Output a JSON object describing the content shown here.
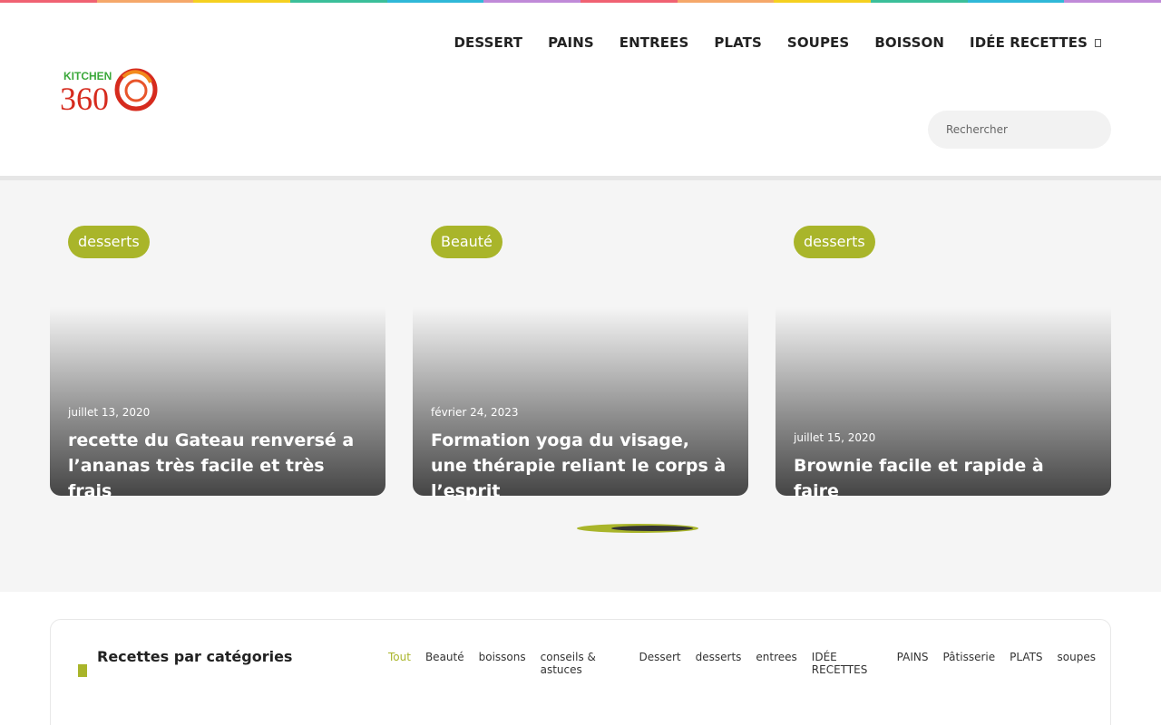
{
  "brand": {
    "logo_text_top": "KITCHEN",
    "logo_text_bottom": "360",
    "colors": {
      "accent": "#a9b52a",
      "logo_green": "#3aa83a",
      "logo_red": "#d62b1e",
      "logo_orange": "#f28a1c"
    }
  },
  "rainbow": [
    "#f06272",
    "#f5a86a",
    "#f5d020",
    "#3bbf9a",
    "#2fb8d8",
    "#c08ad8",
    "#f06272",
    "#f5a86a",
    "#f5d020",
    "#3bbf9a",
    "#2fb8d8",
    "#c08ad8"
  ],
  "nav": {
    "items": [
      "DESSERT",
      "PAINS",
      "ENTREES",
      "PLATS",
      "SOUPES",
      "BOISSON",
      "IDÉE RECETTES"
    ],
    "dropdown_icon": "chevron-down-icon"
  },
  "search": {
    "placeholder": "Rechercher"
  },
  "slider": {
    "cards": [
      {
        "tag": "desserts",
        "date": "juillet 13, 2020",
        "title": "recette du Gateau renversé a l’ananas très facile et très frais"
      },
      {
        "tag": "Beauté",
        "date": "février 24, 2023",
        "title": "Formation yoga du visage, une thérapie reliant le corps à l’esprit"
      },
      {
        "tag": "desserts",
        "date": "juillet 15, 2020",
        "title": "Brownie facile et rapide à faire"
      }
    ]
  },
  "categories": {
    "title": "Recettes par catégories",
    "tabs": [
      "Tout",
      "Beauté",
      "boissons",
      "conseils & astuces",
      "Dessert",
      "desserts",
      "entrees",
      "IDÉE RECETTES",
      "PAINS",
      "Pâtisserie",
      "PLATS",
      "soupes"
    ],
    "active_tab": "Tout"
  }
}
